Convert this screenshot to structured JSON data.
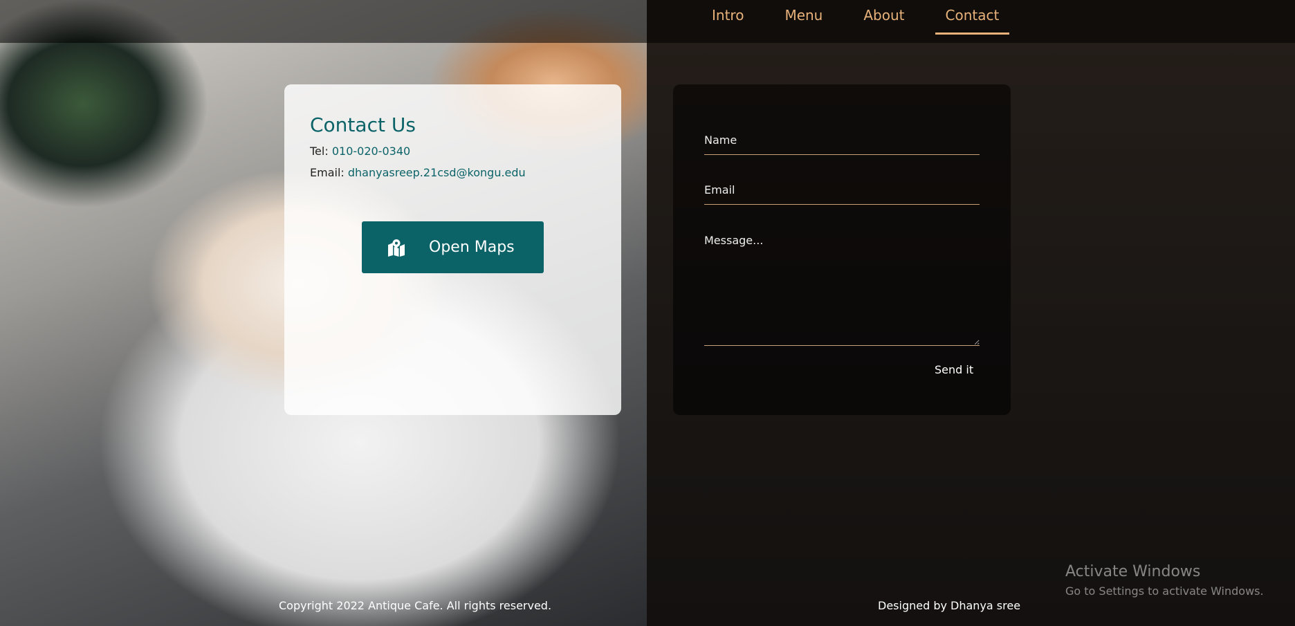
{
  "nav": {
    "items": [
      {
        "label": "Intro"
      },
      {
        "label": "Menu"
      },
      {
        "label": "About"
      },
      {
        "label": "Contact"
      }
    ],
    "active": "Contact",
    "accent_color": "#e8b27a"
  },
  "contact": {
    "title": "Contact Us",
    "tel_label": "Tel:",
    "tel_value": "010-020-0340",
    "email_label": "Email:",
    "email_value": "dhanyasreep.21csd@kongu.edu",
    "maps_button_label": "Open Maps",
    "maps_icon": "map-marker-icon",
    "accent_color": "#0b6368"
  },
  "form": {
    "name_placeholder": "Name",
    "email_placeholder": "Email",
    "message_placeholder": "Message...",
    "send_label": "Send it"
  },
  "footer": {
    "copyright": "Copyright 2022 Antique Cafe. All rights reserved.",
    "designer": "Designed by Dhanya sree"
  },
  "watermark": {
    "title": "Activate Windows",
    "subtitle": "Go to Settings to activate Windows."
  }
}
